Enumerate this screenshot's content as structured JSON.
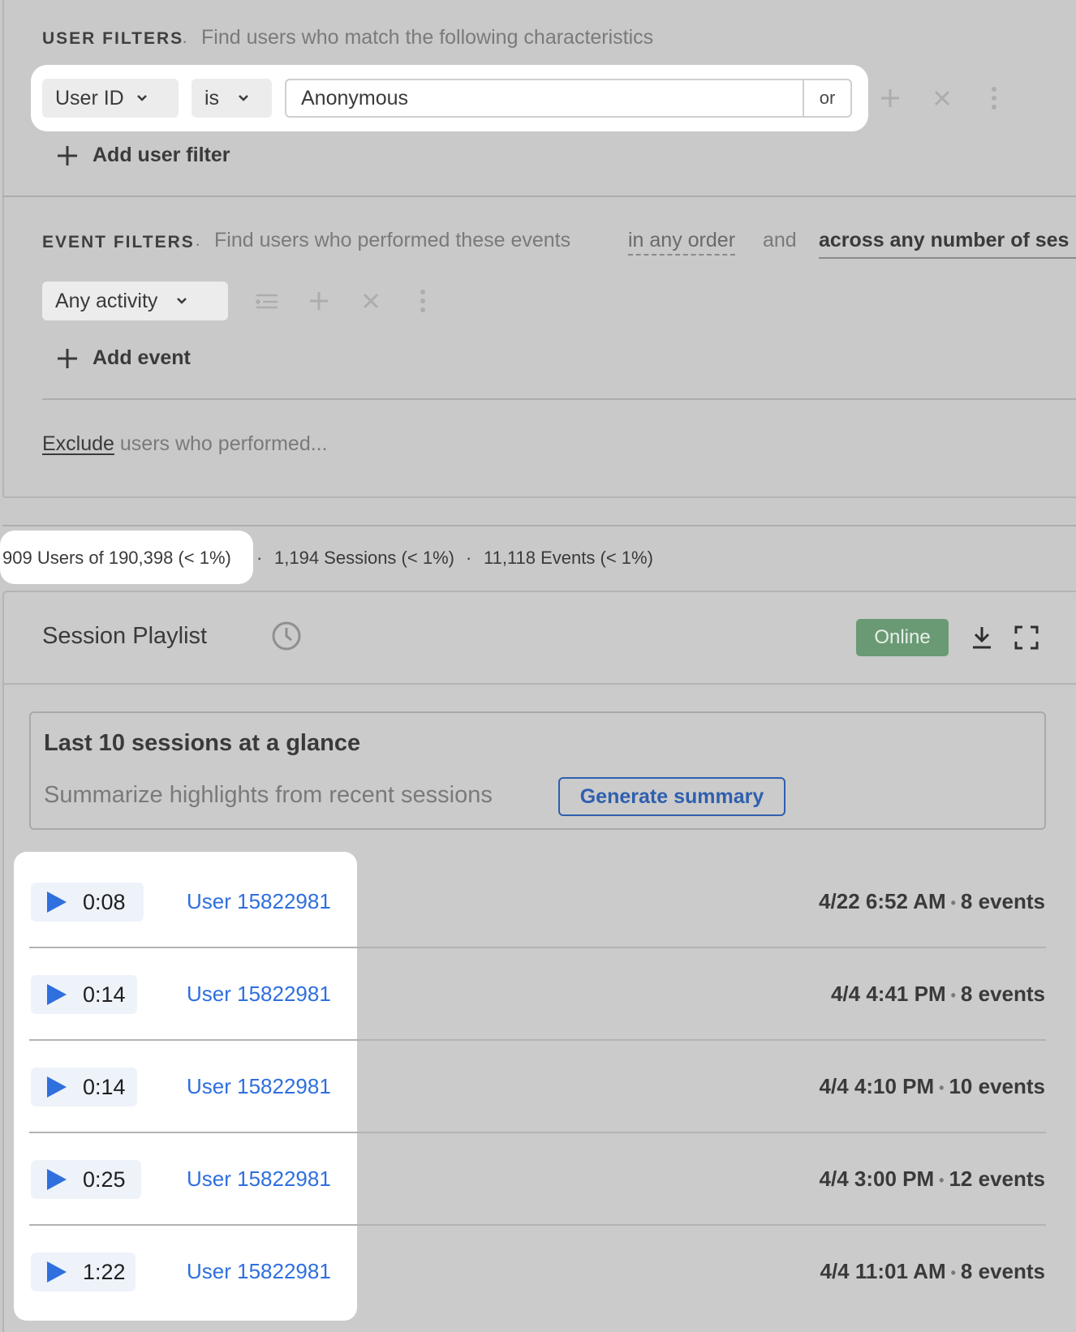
{
  "user_filters": {
    "label": "USER FILTERS",
    "separator": "·",
    "description": "Find users who match the following characteristics",
    "property": "User ID",
    "operator": "is",
    "value": "Anonymous",
    "or_label": "or",
    "add_label": "Add user filter"
  },
  "event_filters": {
    "label": "EVENT FILTERS",
    "separator": "·",
    "description": "Find users who performed these events",
    "order_option": "in any order",
    "conjunction": "and",
    "session_option": "across any number of ses",
    "activity": "Any activity",
    "add_label": "Add event"
  },
  "exclude": {
    "link": "Exclude",
    "text": " users who performed..."
  },
  "stats": {
    "users": "909 Users of 190,398 (< 1%)",
    "sep": "·",
    "sessions": "1,194 Sessions (< 1%)",
    "events": "11,118 Events (< 1%)"
  },
  "playlist": {
    "title": "Session Playlist",
    "status": "Online",
    "glance_title": "Last 10 sessions at a glance",
    "glance_sub": "Summarize highlights from recent sessions",
    "generate_label": "Generate summary",
    "sessions": [
      {
        "duration": "0:08",
        "user": "User 15822981",
        "time": "4/22 6:52 AM",
        "events": "8 events"
      },
      {
        "duration": "0:14",
        "user": "User 15822981",
        "time": "4/4 4:41 PM",
        "events": "8 events"
      },
      {
        "duration": "0:14",
        "user": "User 15822981",
        "time": "4/4 4:10 PM",
        "events": "10 events"
      },
      {
        "duration": "0:25",
        "user": "User 15822981",
        "time": "4/4 3:00 PM",
        "events": "12 events"
      },
      {
        "duration": "1:22",
        "user": "User 15822981",
        "time": "4/4 11:01 AM",
        "events": "8 events"
      }
    ],
    "bullet": "•"
  },
  "colors": {
    "accent_blue": "#2f6fde",
    "online_green": "#6a9a74",
    "background": "#c9c9c9"
  }
}
